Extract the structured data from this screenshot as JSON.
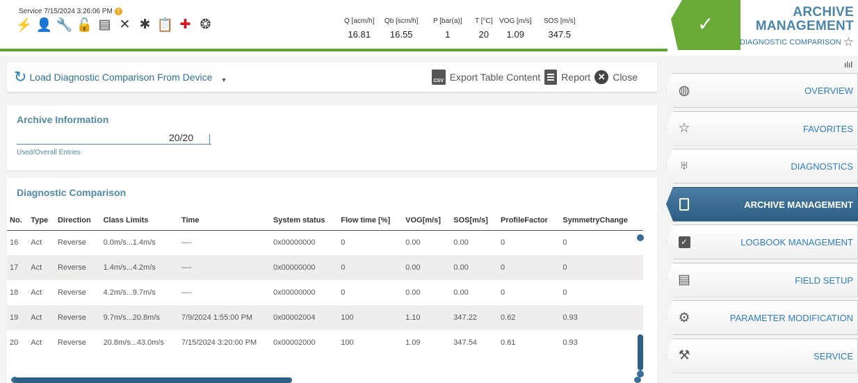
{
  "header": {
    "mode": "Service",
    "datetime": "7/15/2024 3:26:06 PM",
    "warning_glyph": "!",
    "measurements": [
      {
        "label": "Q [acm/h]",
        "value": "16.81"
      },
      {
        "label": "Qb [scm/h]",
        "value": "16.55"
      },
      {
        "label": "P [bar(a)]",
        "value": "1"
      },
      {
        "label": "T [°C]",
        "value": "20"
      },
      {
        "label": "VOG [m/s]",
        "value": "1.09"
      },
      {
        "label": "SOS [m/s]",
        "value": "347.5"
      }
    ],
    "title_line1": "ARCHIVE",
    "title_line2": "MANAGEMENT",
    "subtitle": "DIAGNOSTIC COMPARISON",
    "check_glyph": "✓"
  },
  "toolbar": {
    "load_label": "Load Diagnostic Comparison From Device",
    "export_label": "Export Table Content",
    "report_label": "Report",
    "close_label": "Close",
    "csv_label": "CSV"
  },
  "archive_info": {
    "title": "Archive Information",
    "entries": "20/20",
    "entries_label": "Used/Overall Entries"
  },
  "diagnostic": {
    "title": "Diagnostic Comparison",
    "columns": [
      "No.",
      "Type",
      "Direction",
      "Class Limits",
      "Time",
      "System status",
      "Flow time [%]",
      "VOG[m/s]",
      "SOS[m/s]",
      "ProfileFactor",
      "SymmetryChange"
    ],
    "rows": [
      [
        "16",
        "Act",
        "Reverse",
        "0.0m/s...1.4m/s",
        "----",
        "0x00000000",
        "0",
        "0.00",
        "0.00",
        "0",
        "0"
      ],
      [
        "17",
        "Act",
        "Reverse",
        "1.4m/s...4.2m/s",
        "----",
        "0x00000000",
        "0",
        "0.00",
        "0.00",
        "0",
        "0"
      ],
      [
        "18",
        "Act",
        "Reverse",
        "4.2m/s...9.7m/s",
        "----",
        "0x00000000",
        "0",
        "0.00",
        "0.00",
        "0",
        "0"
      ],
      [
        "19",
        "Act",
        "Reverse",
        "9.7m/s...20.8m/s",
        "7/9/2024 1:55:00 PM",
        "0x00002004",
        "100",
        "1.10",
        "347.22",
        "0.62",
        "0.93"
      ],
      [
        "20",
        "Act",
        "Reverse",
        "20.8m/s...43.0m/s",
        "7/15/2024 3:20:00 PM",
        "0x00002000",
        "100",
        "1.09",
        "347.54",
        "0.61",
        "0.93"
      ]
    ]
  },
  "nav": {
    "extra_glyph": "ılıl",
    "items": [
      {
        "label": "OVERVIEW",
        "icon": "globe-icon",
        "glyph": "🌍",
        "active": false
      },
      {
        "label": "FAVORITES",
        "icon": "star-icon",
        "glyph": "☆",
        "active": false
      },
      {
        "label": "DIAGNOSTICS",
        "icon": "stethoscope-icon",
        "glyph": "ᛃ",
        "active": false
      },
      {
        "label": "ARCHIVE MANAGEMENT",
        "icon": "book-icon",
        "glyph": "",
        "active": true
      },
      {
        "label": "LOGBOOK MANAGEMENT",
        "icon": "logbook-icon",
        "glyph": "✓",
        "active": false
      },
      {
        "label": "FIELD SETUP",
        "icon": "checklist-icon",
        "glyph": "▤",
        "active": false
      },
      {
        "label": "PARAMETER MODIFICATION",
        "icon": "gear-icon",
        "glyph": "⚙",
        "active": false
      },
      {
        "label": "SERVICE",
        "icon": "wrench-icon",
        "glyph": "🔧",
        "active": false
      }
    ]
  }
}
